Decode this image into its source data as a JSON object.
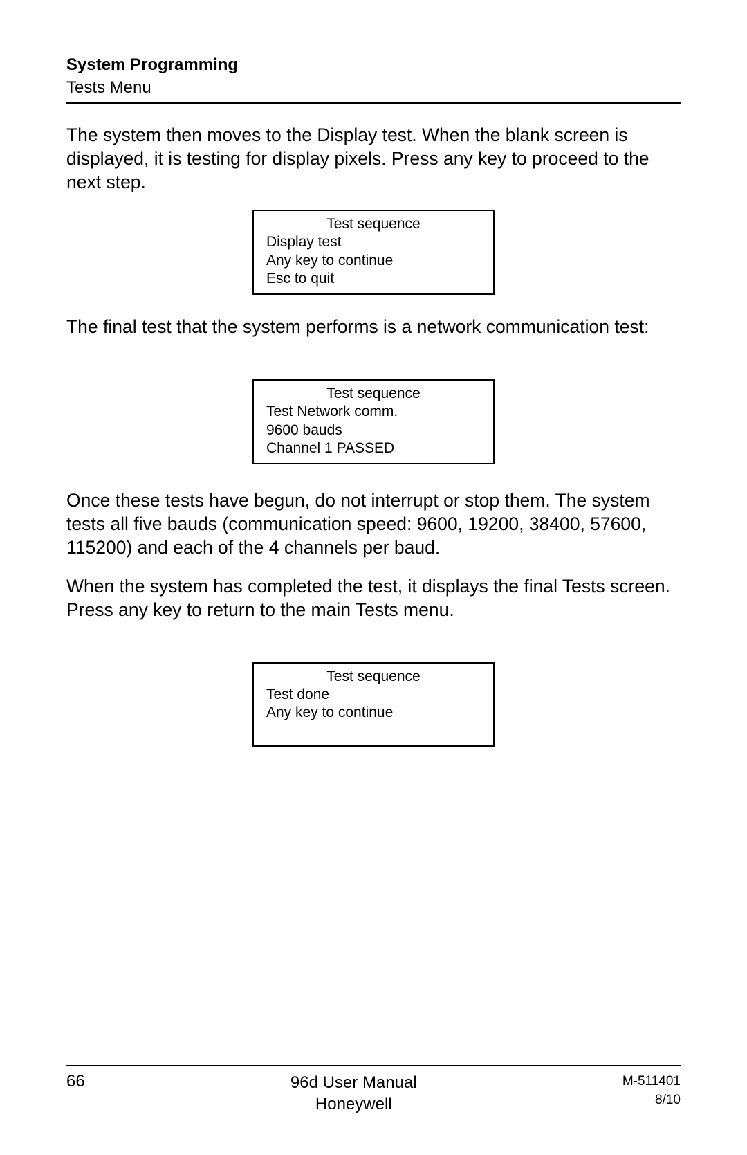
{
  "header": {
    "title": "System Programming",
    "subtitle": "Tests Menu"
  },
  "paragraphs": {
    "p1": "The system then moves to the Display test.  When the blank screen is displayed, it is testing for display pixels. Press any key to proceed to the next step.",
    "p2": "The final test that the system performs is a network communication test:",
    "p3": "Once these tests have begun, do not interrupt or stop them.  The system tests all five bauds (communication speed: 9600, 19200, 38400, 57600, 115200) and each of the 4 channels per baud.",
    "p4": "When the system has completed the test, it displays the final Tests screen. Press any key to return to the main Tests menu."
  },
  "lcd1": {
    "l1": "Test sequence",
    "l2": "Display test",
    "l3": "Any key to continue",
    "l4": "Esc to quit"
  },
  "lcd2": {
    "l1": "Test sequence",
    "l2": "Test Network comm.",
    "l3": "9600 bauds",
    "l4": "Channel 1 PASSED"
  },
  "lcd3": {
    "l1": "Test sequence",
    "l2": "Test done",
    "l3": "Any key to continue"
  },
  "footer": {
    "page_number": "66",
    "center_line1": "96d User Manual",
    "center_line2": "Honeywell",
    "right_line1": "M-511401",
    "right_line2": "8/10"
  }
}
